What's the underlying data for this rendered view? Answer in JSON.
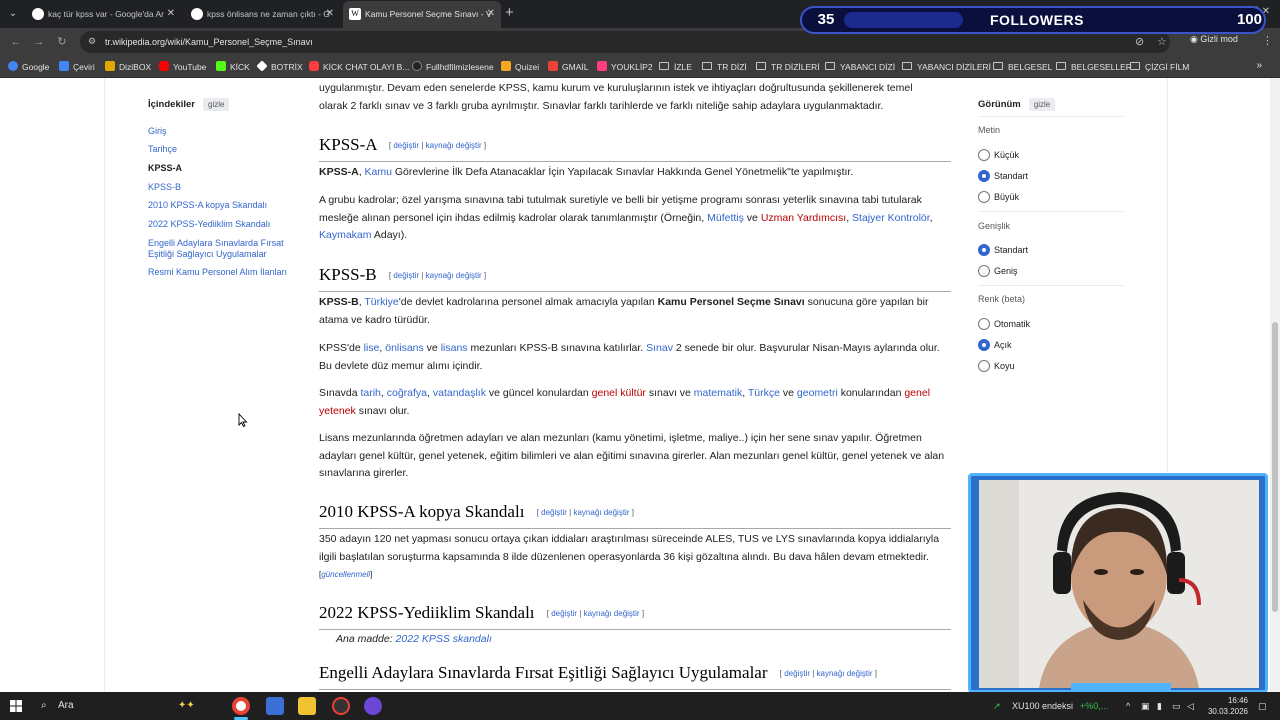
{
  "browser": {
    "tabs": [
      {
        "title": "kaç tür kpss var - Google'da Ar",
        "favicon_color": "#4285f4"
      },
      {
        "title": "kpss önlisans ne zaman çıktı - G",
        "favicon_color": "#4285f4"
      },
      {
        "title": "Kamu Personel Seçme Sınavı - V",
        "favicon_color": "#ffffff",
        "active": true
      }
    ],
    "url": "tr.wikipedia.org/wiki/Kamu_Personel_Seçme_Sınavı",
    "incognito_label": "Gizli mod",
    "bookmarks": [
      {
        "label": "Google",
        "icon_color": "#4285f4"
      },
      {
        "label": "Çeviri",
        "icon_color": "#4285f4"
      },
      {
        "label": "DiziBOX",
        "icon_color": "#e0a800"
      },
      {
        "label": "YouTube",
        "icon_color": "#ff0000"
      },
      {
        "label": "KİCK",
        "icon_color": "#53fc18"
      },
      {
        "label": "BOTRİX",
        "icon_color": "#ffffff"
      },
      {
        "label": "KİCK CHAT OLAYI B...",
        "icon_color": "#ff3d3d"
      },
      {
        "label": "Fullhdfilmizlesene",
        "icon_color": "#222222"
      },
      {
        "label": "Quizei",
        "icon_color": "#f5a623"
      },
      {
        "label": "GMAİL",
        "icon_color": "#ea4335"
      },
      {
        "label": "YOUKLİP2",
        "icon_color": "#ff3d7f"
      },
      {
        "label": "İZLE",
        "folder": true
      },
      {
        "label": "TR DİZİ",
        "folder": true
      },
      {
        "label": "TR DİZİLERİ",
        "folder": true
      },
      {
        "label": "YABANCI DİZİ",
        "folder": true
      },
      {
        "label": "YABANCI DİZİLERİ",
        "folder": true
      },
      {
        "label": "BELGESEL",
        "folder": true
      },
      {
        "label": "BELGESELLER",
        "folder": true
      },
      {
        "label": "ÇİZGİ FİLM",
        "folder": true
      }
    ]
  },
  "overlay": {
    "followers_count": "35",
    "followers_label": "FOLLOWERS",
    "followers_goal": "100",
    "followers_progress": 0.35
  },
  "toc": {
    "title": "İçindekiler",
    "hide_label": "gizle",
    "items": [
      {
        "label": "Giriş"
      },
      {
        "label": "Tarihçe"
      },
      {
        "label": "KPSS-A",
        "current": true
      },
      {
        "label": "KPSS-B"
      },
      {
        "label": "2010 KPSS-A kopya Skandalı"
      },
      {
        "label": "2022 KPSS-Yediiklim Skandalı"
      },
      {
        "label": "Engelli Adaylara Sınavlarda Fırsat Eşitliği Sağlayıcı Uygulamalar"
      },
      {
        "label": "Resmi Kamu Personel Alım İlanları"
      }
    ]
  },
  "article": {
    "intro_line1": "uygulanmıştır. Devam eden senelerde KPSS, kamu kurum ve kuruluşlarının istek ve ihtiyaçları doğrultusunda şekillenerek temel",
    "intro_line2": "olarak 2 farklı sınav ve 3 farklı gruba ayrılmıştır. Sınavlar farklı tarihlerde ve farklı niteliğe sahip adaylara uygulanmaktadır.",
    "edit": "değiştir",
    "edit_source": "kaynağı değiştir",
    "kpssa": {
      "heading": "KPSS-A",
      "p1_bold": "KPSS-A",
      "p1_link": "Kamu",
      "p1_rest": " Görevlerine İlk Defa Atanacaklar İçin Yapılacak Sınavlar Hakkında Genel Yönetmelik\"te yapılmıştır.",
      "p2_text": "A grubu kadrolar; özel yarışma sınavına tabi tutulmak suretiyle ve belli bir yetişme programı sonrası yeterlik sınavına tabi tutularak mesleğe alınan personel için ihdas edilmiş kadrolar olarak tanımlanmıştır (Örneğin, ",
      "p2_l1": "Müfettiş",
      "p2_ve": " ve ",
      "p2_l2": "Uzman Yardımcısı",
      "p2_comma": ", ",
      "p2_l3": "Stajyer Kontrolör",
      "p2_comma2": ", ",
      "p2_l4": "Kaymakam",
      "p2_end": " Adayı)."
    },
    "kpssb": {
      "heading": "KPSS-B",
      "p1_bold": "KPSS-B",
      "p1_link": "Türkiye",
      "p1_mid": "'de devlet kadrolarına personel almak amacıyla yapılan ",
      "p1_bold2": "Kamu Personel Seçme Sınavı",
      "p1_end": " sonucuna göre yapılan bir atama ve kadro türüdür.",
      "p2_a": "KPSS'de ",
      "p2_l1": "lise",
      "p2_c": ", ",
      "p2_l2": "önlisans",
      "p2_ve": " ve ",
      "p2_l3": "lisans",
      "p2_b": " mezunları KPSS-B sınavına katılırlar. ",
      "p2_l4": "Sınav",
      "p2_end": " 2 senede bir olur. Başvurular Nisan-Mayıs aylarında olur. Bu devlete düz memur alımı içindir.",
      "p3_a": "Sınavda ",
      "p3_l1": "tarih",
      "p3_c1": ", ",
      "p3_l2": "coğrafya",
      "p3_c2": ", ",
      "p3_l3": "vatandaşlık",
      "p3_b": " ve güncel konulardan ",
      "p3_l4": "genel kültür",
      "p3_c": " sınavı ve ",
      "p3_l5": "matematik",
      "p3_c3": ", ",
      "p3_l6": "Türkçe",
      "p3_ve": " ve ",
      "p3_l7": "geometri",
      "p3_d": " konularından ",
      "p3_l8": "genel yetenek",
      "p3_end": " sınavı olur.",
      "p4": "Lisans mezunlarında öğretmen adayları ve alan mezunları (kamu yönetimi, işletme, maliye..) için her sene sınav yapılır. Öğretmen adayları genel kültür, genel yetenek, eğitim bilimleri ve alan eğitimi sınavına girerler. Alan mezunları genel kültür, genel yetenek ve alan sınavlarına girerler."
    },
    "scandal2010": {
      "heading": "2010 KPSS-A kopya Skandalı",
      "p1": "350 adayın 120 net yapması sonucu ortaya çıkan iddiaları araştırılması süreceinde ALES, TUS ve LYS sınavlarında kopya iddialarıyla ilgili başlatılan soruşturma kapsamında 8 ilde düzenlenen operasyonlarda 36 kişi gözaltına alındı. Bu dava hâlen devam etmektedir.",
      "note": "güncellenmeli"
    },
    "scandal2022": {
      "heading": "2022 KPSS-Yediiklim Skandalı",
      "hatnote_label": "Ana madde: ",
      "hatnote_link": "2022 KPSS skandalı"
    },
    "engelli": {
      "heading": "Engelli Adaylara Sınavlarda Fırsat Eşitliği Sağlayıcı Uygulamalar"
    }
  },
  "appearance": {
    "title": "Görünüm",
    "hide_label": "gizle",
    "text_group": "Metin",
    "text_options": [
      "Küçük",
      "Standart",
      "Büyük"
    ],
    "text_selected": 1,
    "width_group": "Genişlik",
    "width_options": [
      "Standart",
      "Geniş"
    ],
    "width_selected": 0,
    "color_group": "Renk (beta)",
    "color_options": [
      "Otomatik",
      "Açık",
      "Koyu"
    ],
    "color_selected": 1
  },
  "taskbar": {
    "search_label": "Ara",
    "ticker": "XU100 endeksi",
    "ticker_change": "+%0,...",
    "time": "16:46",
    "date": "30.03.2026"
  }
}
